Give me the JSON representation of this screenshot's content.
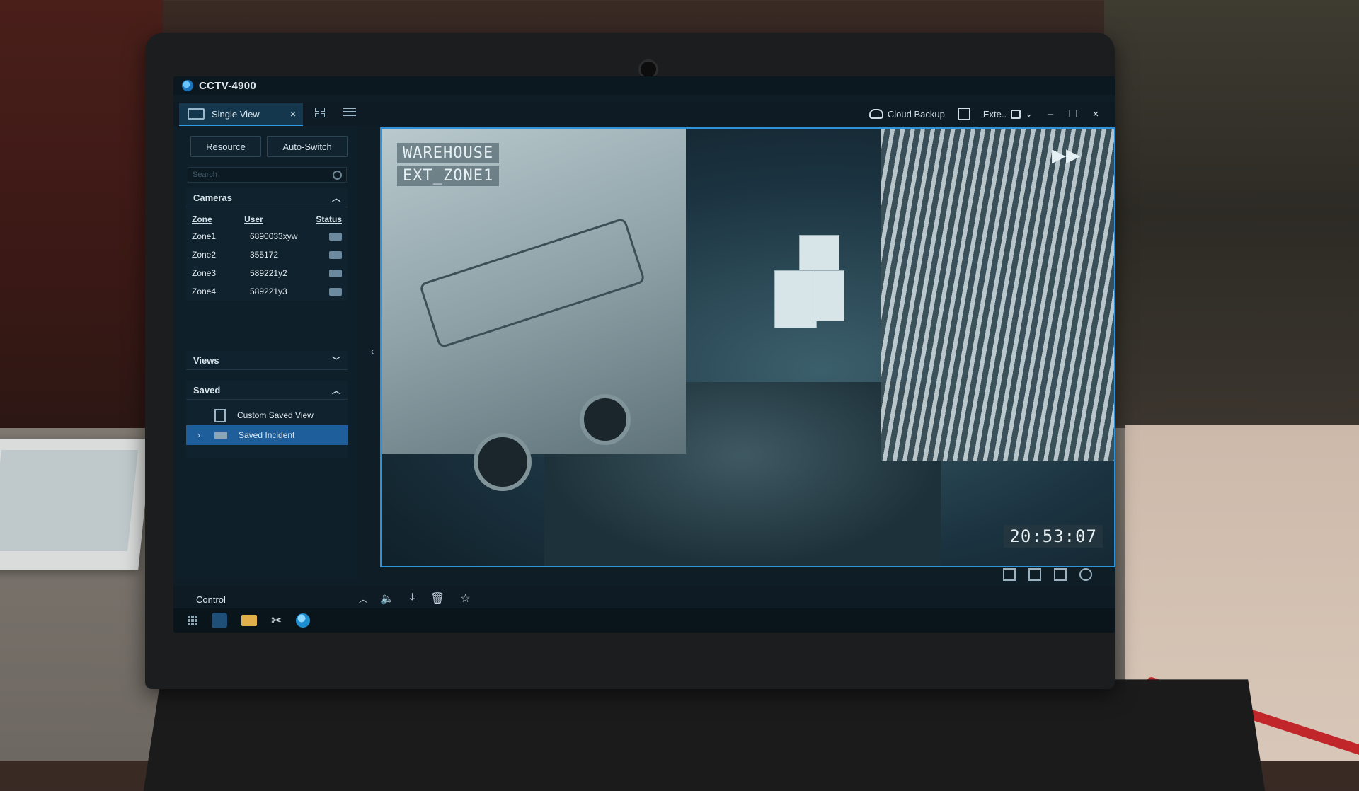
{
  "app": {
    "title": "CCTV-4900"
  },
  "tabs": {
    "single_view": "Single View",
    "close_symbol": "×"
  },
  "topbar": {
    "cloud_backup": "Cloud Backup",
    "ext": "Exte..",
    "minimize": "–",
    "maximize": "☐",
    "close": "×"
  },
  "left": {
    "resource_label": "Resource",
    "auto_switch_label": "Auto-Switch",
    "search_placeholder": "Search",
    "cameras": {
      "title": "Cameras",
      "cols": {
        "zone": "Zone",
        "user": "User",
        "status": "Status"
      },
      "rows": [
        {
          "zone": "Zone1",
          "user": "6890033xyw"
        },
        {
          "zone": "Zone2",
          "user": "355172"
        },
        {
          "zone": "Zone3",
          "user": "589221y2"
        },
        {
          "zone": "Zone4",
          "user": "589221y3"
        }
      ]
    },
    "views_title": "Views",
    "saved": {
      "title": "Saved",
      "items": [
        {
          "label": "Custom Saved View"
        },
        {
          "label": "Saved Incident"
        }
      ]
    },
    "control_label": "Control"
  },
  "video": {
    "osd_location": "WAREHOUSE",
    "osd_zone": "EXT_ZONE1",
    "timestamp": "20:53:07"
  },
  "colors": {
    "accent": "#2e93d9",
    "selection": "#1e5f9b",
    "panel": "#0f1f2a"
  },
  "icons": [
    "app-logo-icon",
    "camera-icon",
    "grid-icon",
    "list-icon",
    "cloud-icon",
    "lock-icon",
    "search-icon",
    "status-icon",
    "document-icon",
    "fast-forward-icon",
    "speaker-icon",
    "download-icon",
    "trash-icon",
    "star-icon",
    "folder-icon",
    "tools-icon",
    "globe-icon"
  ]
}
